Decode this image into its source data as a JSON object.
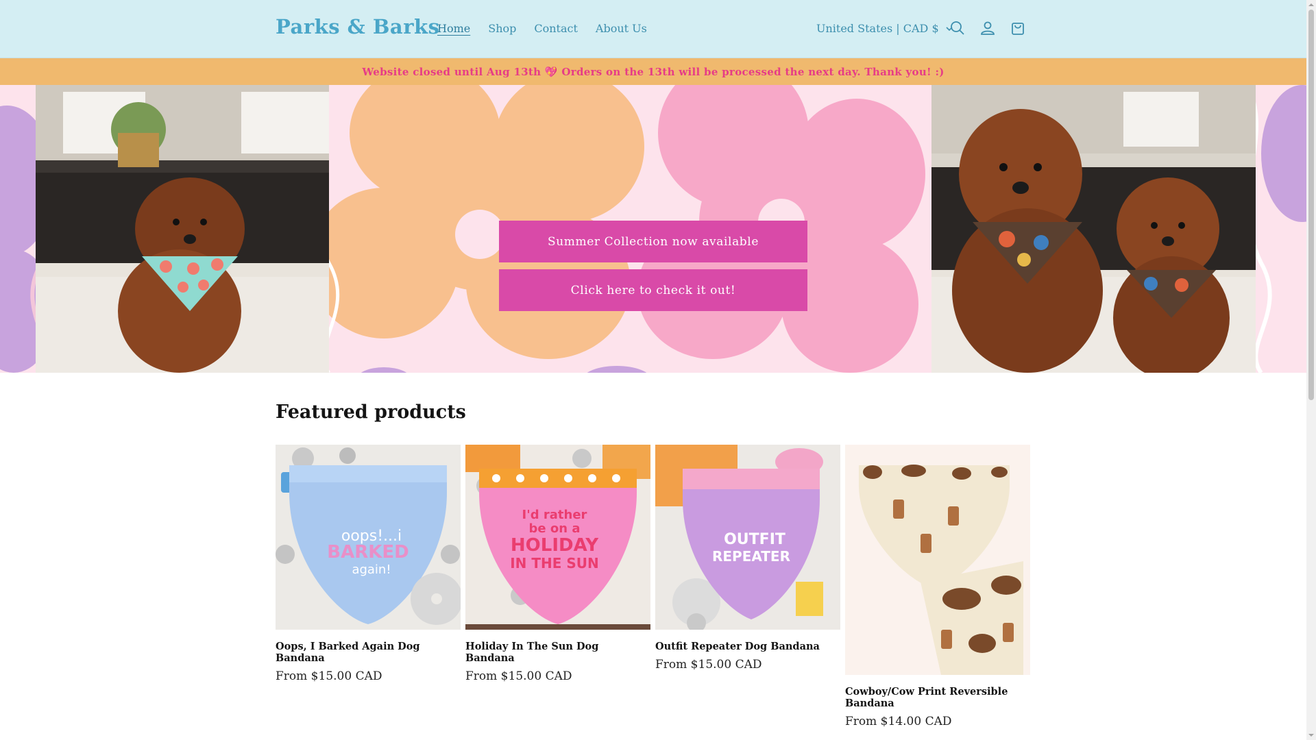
{
  "header": {
    "logo": "Parks & Barks",
    "nav": [
      {
        "label": "Home",
        "active": true
      },
      {
        "label": "Shop",
        "active": false
      },
      {
        "label": "Contact",
        "active": false
      },
      {
        "label": "About Us",
        "active": false
      }
    ],
    "country_selector": "United States | CAD $",
    "icons": [
      "search-icon",
      "account-icon",
      "cart-icon"
    ]
  },
  "announcement": "Website closed until Aug 13th 💖 Orders on the 13th will be processed the next day. Thank you! :)",
  "hero": {
    "button_primary": "Summer Collection now available",
    "button_secondary": "Click here to check it out!"
  },
  "featured": {
    "heading": "Featured products",
    "products": [
      {
        "title": "Oops, I Barked Again Dog Bandana",
        "price": "From $15.00 CAD",
        "image_text": [
          "oops!...i",
          "BARKED",
          "again!"
        ]
      },
      {
        "title": "Holiday In The Sun Dog Bandana",
        "price": "From $15.00 CAD",
        "image_text": [
          "I'd rather",
          "be on a",
          "HOLIDAY",
          "IN THE SUN"
        ]
      },
      {
        "title": "Outfit Repeater Dog Bandana",
        "price": "From $15.00 CAD",
        "image_text": [
          "OUTFIT",
          "REPEATER"
        ]
      },
      {
        "title": "Cowboy/Cow Print Reversible Bandana",
        "price": "From $14.00 CAD",
        "image_text": []
      }
    ]
  },
  "colors": {
    "header_bg": "#d4eef3",
    "brand_blue": "#4aa6c8",
    "announce_bg": "#f0b96e",
    "announce_text": "#e63c86",
    "hero_button": "#d94aa8"
  }
}
